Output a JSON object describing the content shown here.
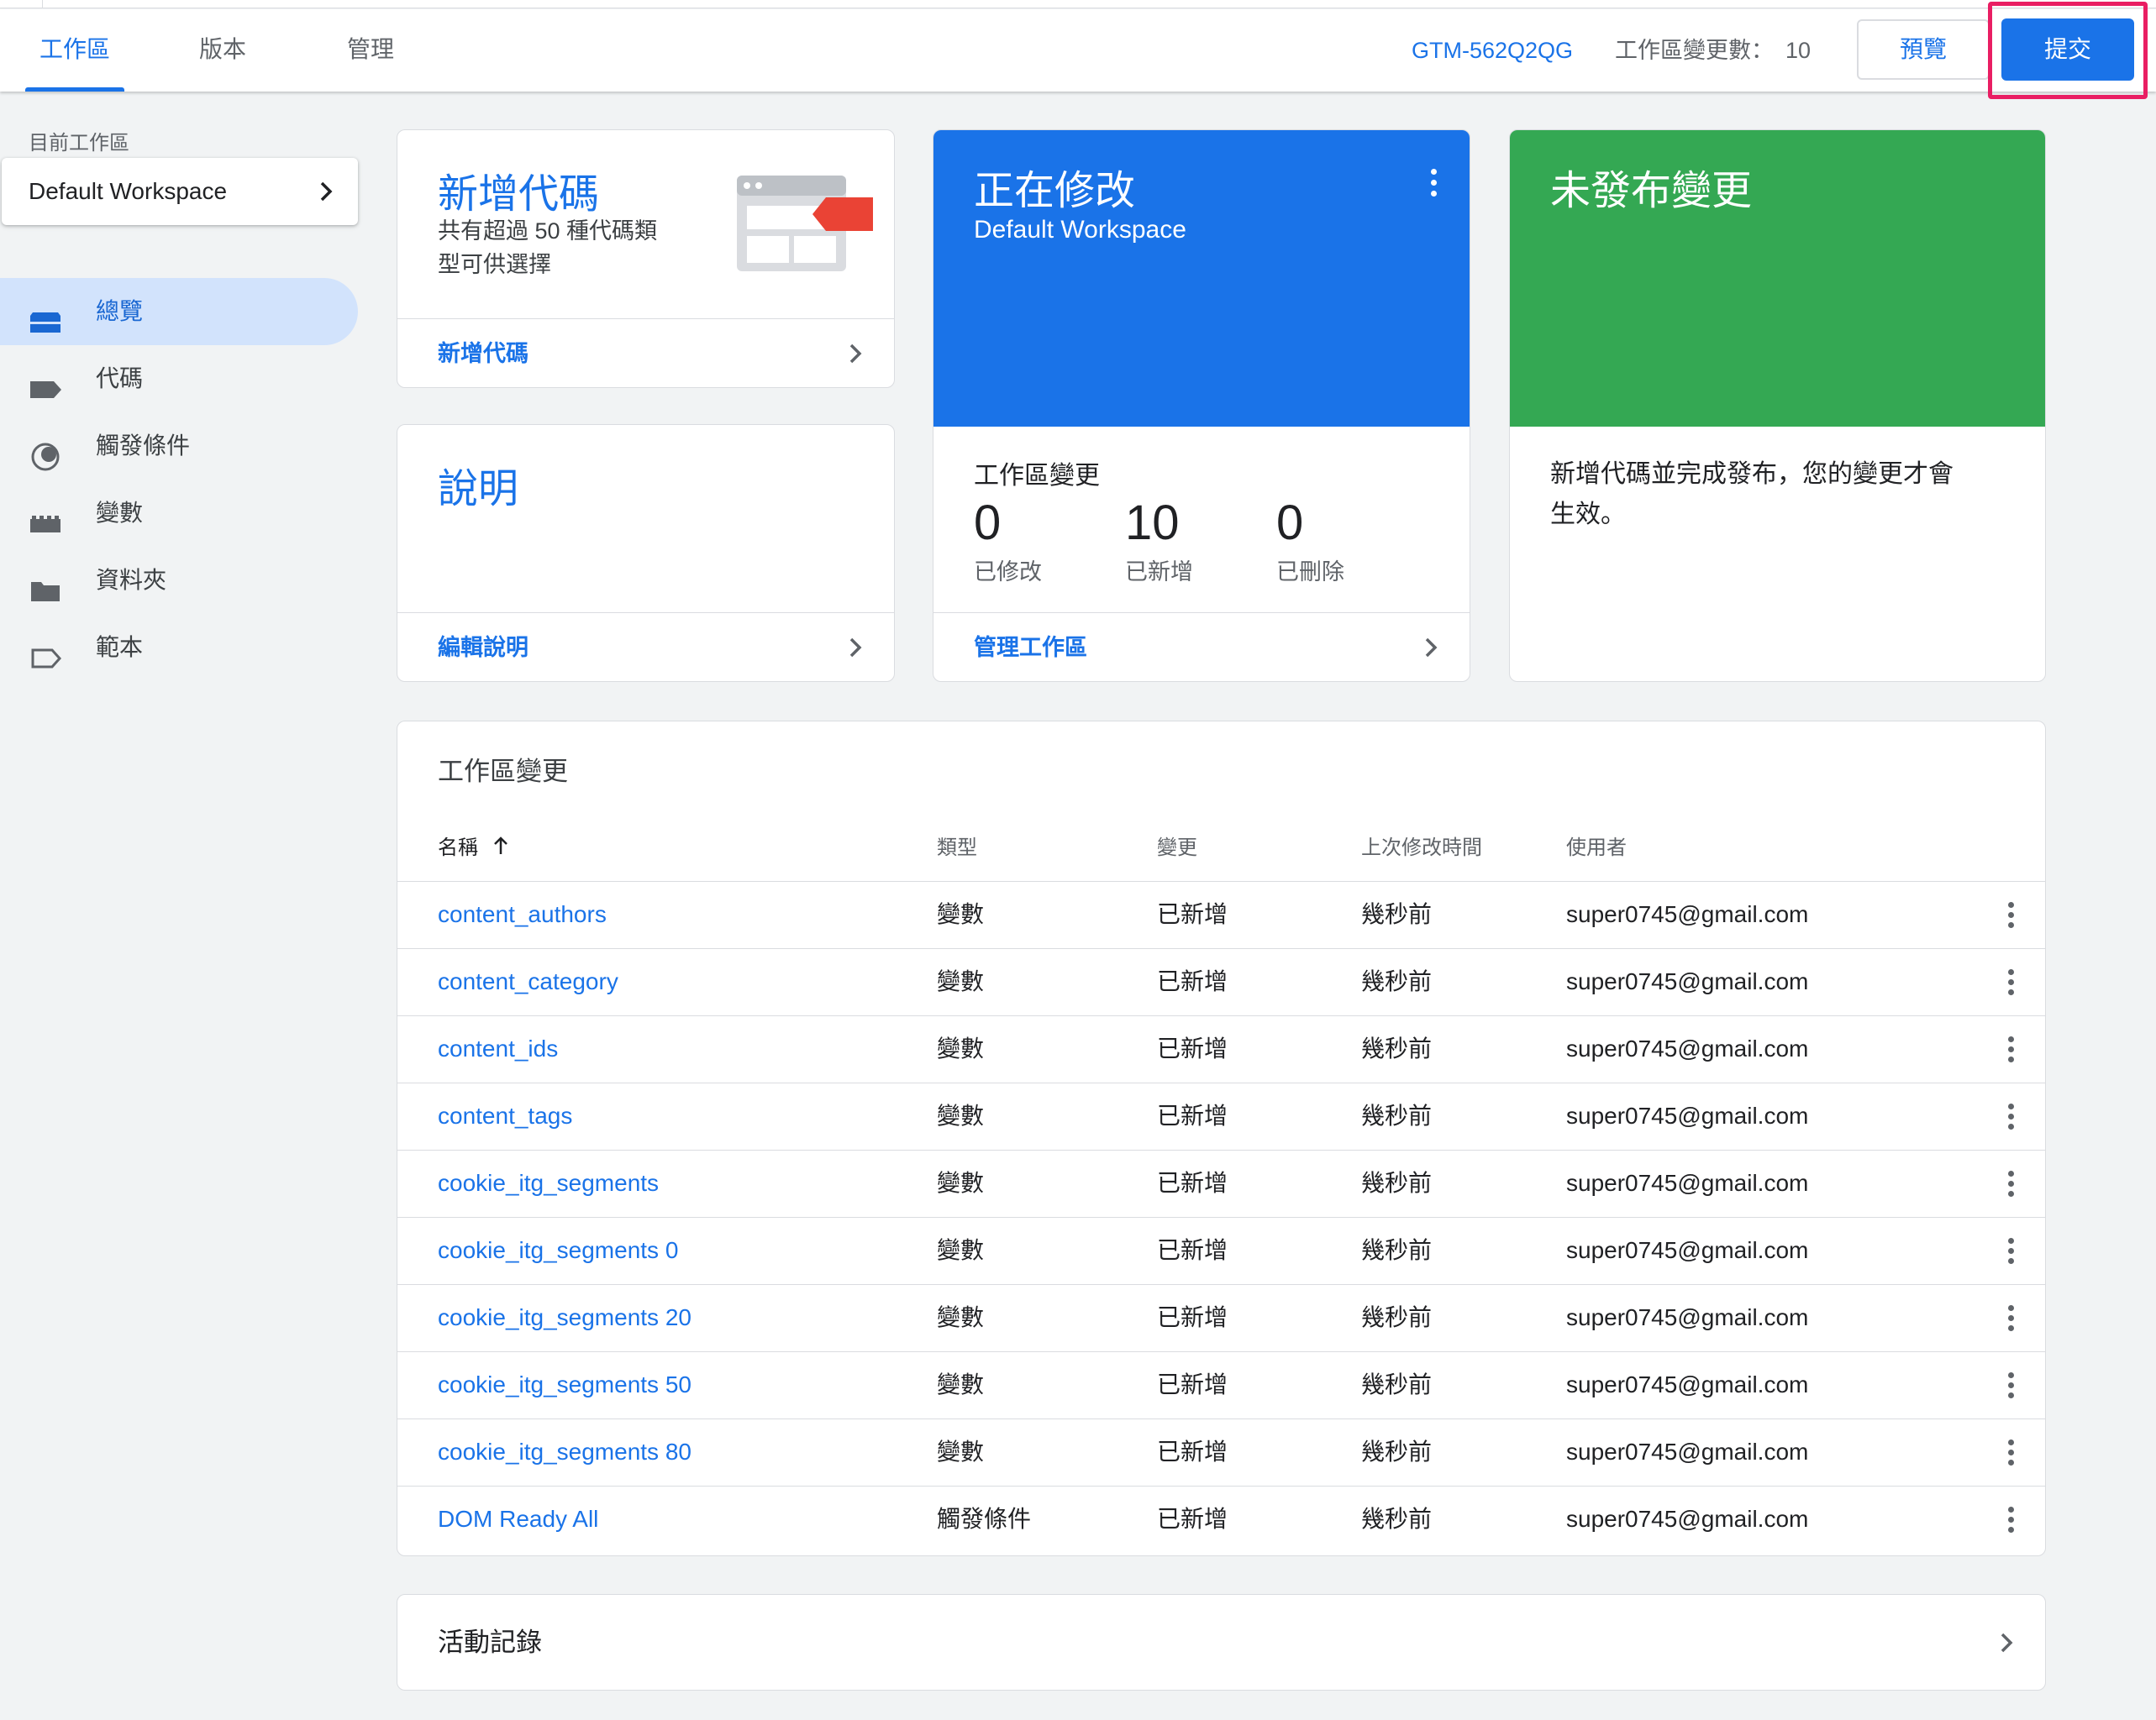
{
  "topbar": {
    "tabs": [
      {
        "label": "工作區",
        "active": true
      },
      {
        "label": "版本",
        "active": false
      },
      {
        "label": "管理",
        "active": false
      }
    ],
    "container_id": "GTM-562Q2QG",
    "workspace_changes_label": "工作區變更數：",
    "workspace_changes_count": "10",
    "preview_label": "預覽",
    "submit_label": "提交"
  },
  "sidebar": {
    "current_workspace_label": "目前工作區",
    "workspace_name": "Default Workspace",
    "items": [
      {
        "label": "總覽",
        "icon": "overview-icon",
        "active": true
      },
      {
        "label": "代碼",
        "icon": "tag-icon",
        "active": false
      },
      {
        "label": "觸發條件",
        "icon": "trigger-icon",
        "active": false
      },
      {
        "label": "變數",
        "icon": "variable-icon",
        "active": false
      },
      {
        "label": "資料夾",
        "icon": "folder-icon",
        "active": false
      },
      {
        "label": "範本",
        "icon": "template-icon",
        "active": false
      }
    ]
  },
  "cards": {
    "new_tag": {
      "title": "新增代碼",
      "description_line1": "共有超過 50 種代碼類",
      "description_line2": "型可供選擇",
      "footer": "新增代碼"
    },
    "description": {
      "title": "說明",
      "footer": "編輯說明"
    },
    "editing": {
      "title": "正在修改",
      "subtitle": "Default Workspace",
      "section_label": "工作區變更",
      "stats": [
        {
          "value": "0",
          "label": "已修改"
        },
        {
          "value": "10",
          "label": "已新增"
        },
        {
          "value": "0",
          "label": "已刪除"
        }
      ],
      "footer": "管理工作區",
      "header_color": "#1a73e8"
    },
    "unpublished": {
      "title": "未發布變更",
      "description_line1": "新增代碼並完成發布，您的變更才會",
      "description_line2": "生效。",
      "header_color": "#34a853"
    }
  },
  "changes_table": {
    "title": "工作區變更",
    "columns": {
      "name": "名稱",
      "type": "類型",
      "change": "變更",
      "modified": "上次修改時間",
      "user": "使用者"
    },
    "rows": [
      {
        "name": "content_authors",
        "type": "變數",
        "change": "已新增",
        "modified": "幾秒前",
        "user": "super0745@gmail.com"
      },
      {
        "name": "content_category",
        "type": "變數",
        "change": "已新增",
        "modified": "幾秒前",
        "user": "super0745@gmail.com"
      },
      {
        "name": "content_ids",
        "type": "變數",
        "change": "已新增",
        "modified": "幾秒前",
        "user": "super0745@gmail.com"
      },
      {
        "name": "content_tags",
        "type": "變數",
        "change": "已新增",
        "modified": "幾秒前",
        "user": "super0745@gmail.com"
      },
      {
        "name": "cookie_itg_segments",
        "type": "變數",
        "change": "已新增",
        "modified": "幾秒前",
        "user": "super0745@gmail.com"
      },
      {
        "name": "cookie_itg_segments 0",
        "type": "變數",
        "change": "已新增",
        "modified": "幾秒前",
        "user": "super0745@gmail.com"
      },
      {
        "name": "cookie_itg_segments 20",
        "type": "變數",
        "change": "已新增",
        "modified": "幾秒前",
        "user": "super0745@gmail.com"
      },
      {
        "name": "cookie_itg_segments 50",
        "type": "變數",
        "change": "已新增",
        "modified": "幾秒前",
        "user": "super0745@gmail.com"
      },
      {
        "name": "cookie_itg_segments 80",
        "type": "變數",
        "change": "已新增",
        "modified": "幾秒前",
        "user": "super0745@gmail.com"
      },
      {
        "name": "DOM Ready All",
        "type": "觸發條件",
        "change": "已新增",
        "modified": "幾秒前",
        "user": "super0745@gmail.com"
      }
    ]
  },
  "activity": {
    "title": "活動記錄"
  }
}
